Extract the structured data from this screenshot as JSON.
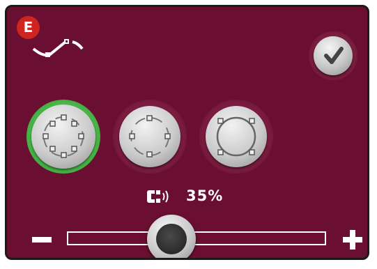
{
  "panel": {
    "badge_letter": "E",
    "stitch_icon": "stitch-curve-icon",
    "confirm_icon": "checkmark-icon"
  },
  "hoop_modes": [
    {
      "name": "hoop-mode-full-points",
      "icon": "hoop-eight-points-icon",
      "selected": true
    },
    {
      "name": "hoop-mode-four-points",
      "icon": "hoop-four-points-icon",
      "selected": false
    },
    {
      "name": "hoop-mode-corner-points",
      "icon": "hoop-corner-points-icon",
      "selected": false
    }
  ],
  "slider": {
    "icon": "magnet-sound-icon",
    "percent_label": "35%",
    "value_percent": 35,
    "decrease_icon": "minus-icon",
    "increase_icon": "plus-icon"
  },
  "colors": {
    "background": "#6a0f31",
    "selected_ring": "#4ab94a",
    "badge": "#cf2420"
  }
}
